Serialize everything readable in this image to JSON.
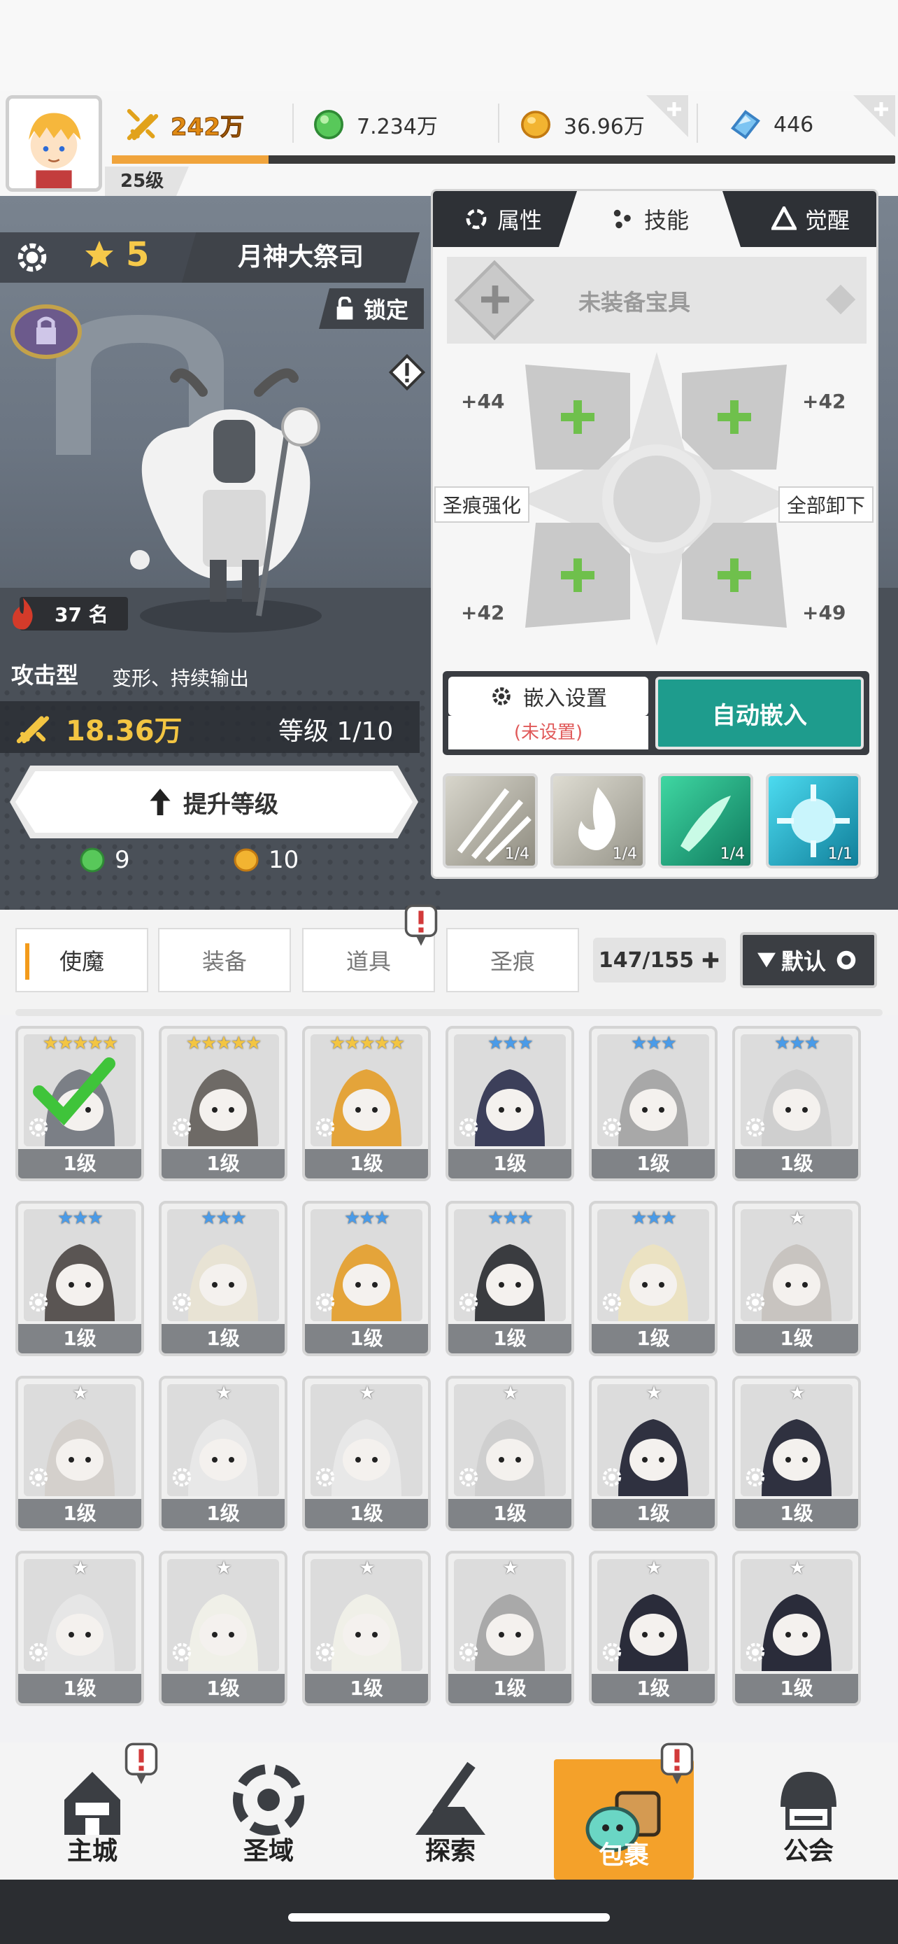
{
  "top": {
    "level": "25级",
    "power": "242万",
    "green_gems": "7.234万",
    "gold": "36.96万",
    "crystals": "446",
    "exp_progress": 0.2
  },
  "hero": {
    "star_count": "5",
    "name": "月神大祭司",
    "lock_label": "锁定",
    "hot_rank": "37 名",
    "hot_label": "热",
    "type": "攻击型",
    "type_desc": "变形、持续输出",
    "power": "18.36万",
    "level_label": "等级 1/10",
    "upgrade_label": "提升等级",
    "cost_green": "9",
    "cost_gold": "10"
  },
  "panel": {
    "tabs": [
      "属性",
      "技能",
      "觉醒"
    ],
    "active_tab": 1,
    "treasure_label": "未装备宝具",
    "socket_values": [
      "+44",
      "+42",
      "+42",
      "+49"
    ],
    "left_label": "圣痕强化",
    "right_label": "全部卸下",
    "embed_setting": "嵌入设置",
    "embed_status": "(未设置)",
    "auto_embed": "自动嵌入",
    "skill_counts": [
      "1/4",
      "1/4",
      "1/4",
      "1/1"
    ]
  },
  "inventory": {
    "tabs": [
      "使魔",
      "装备",
      "道具",
      "圣痕"
    ],
    "count": "147/155",
    "sort_label": "默认",
    "cards": [
      {
        "stars": "★★★★★",
        "level": "1级",
        "color": "#7b7f86",
        "selected": true
      },
      {
        "stars": "★★★★★",
        "level": "1级",
        "color": "#6e6a66",
        "selected": false
      },
      {
        "stars": "★★★★★",
        "level": "1级",
        "color": "#e4a43a",
        "selected": false
      },
      {
        "stars": "★★★",
        "level": "1级",
        "color": "#3c3f5a",
        "selected": false
      },
      {
        "stars": "★★★",
        "level": "1级",
        "color": "#a8a8a8",
        "selected": false
      },
      {
        "stars": "★★★",
        "level": "1级",
        "color": "#cfcfcf",
        "selected": false
      },
      {
        "stars": "★★★",
        "level": "1级",
        "color": "#5a5553",
        "selected": false
      },
      {
        "stars": "★★★",
        "level": "1级",
        "color": "#e8e3d4",
        "selected": false
      },
      {
        "stars": "★★★",
        "level": "1级",
        "color": "#e4a43a",
        "selected": false
      },
      {
        "stars": "★★★",
        "level": "1级",
        "color": "#3a3c40",
        "selected": false
      },
      {
        "stars": "★★★",
        "level": "1级",
        "color": "#ebe2c2",
        "selected": false
      },
      {
        "stars": "★",
        "level": "1级",
        "color": "#c8c4c0",
        "selected": false
      },
      {
        "stars": "★",
        "level": "1级",
        "color": "#d4d0cc",
        "selected": false
      },
      {
        "stars": "★",
        "level": "1级",
        "color": "#e8e8e8",
        "selected": false
      },
      {
        "stars": "★",
        "level": "1级",
        "color": "#e8e8e8",
        "selected": false
      },
      {
        "stars": "★",
        "level": "1级",
        "color": "#cfcfcf",
        "selected": false
      },
      {
        "stars": "★",
        "level": "1级",
        "color": "#2f3140",
        "selected": false
      },
      {
        "stars": "★",
        "level": "1级",
        "color": "#2f3140",
        "selected": false
      },
      {
        "stars": "★",
        "level": "1级",
        "color": "#e6e6e6",
        "selected": false
      },
      {
        "stars": "★",
        "level": "1级",
        "color": "#f0f0e8",
        "selected": false
      },
      {
        "stars": "★",
        "level": "1级",
        "color": "#f0f0e8",
        "selected": false
      },
      {
        "stars": "★",
        "level": "1级",
        "color": "#a9a9a9",
        "selected": false
      },
      {
        "stars": "★",
        "level": "1级",
        "color": "#2a2c3a",
        "selected": false
      },
      {
        "stars": "★",
        "level": "1级",
        "color": "#2a2c3a",
        "selected": false
      }
    ]
  },
  "nav": {
    "items": [
      "主城",
      "圣域",
      "探索",
      "包裹",
      "公会"
    ],
    "active": 3
  }
}
